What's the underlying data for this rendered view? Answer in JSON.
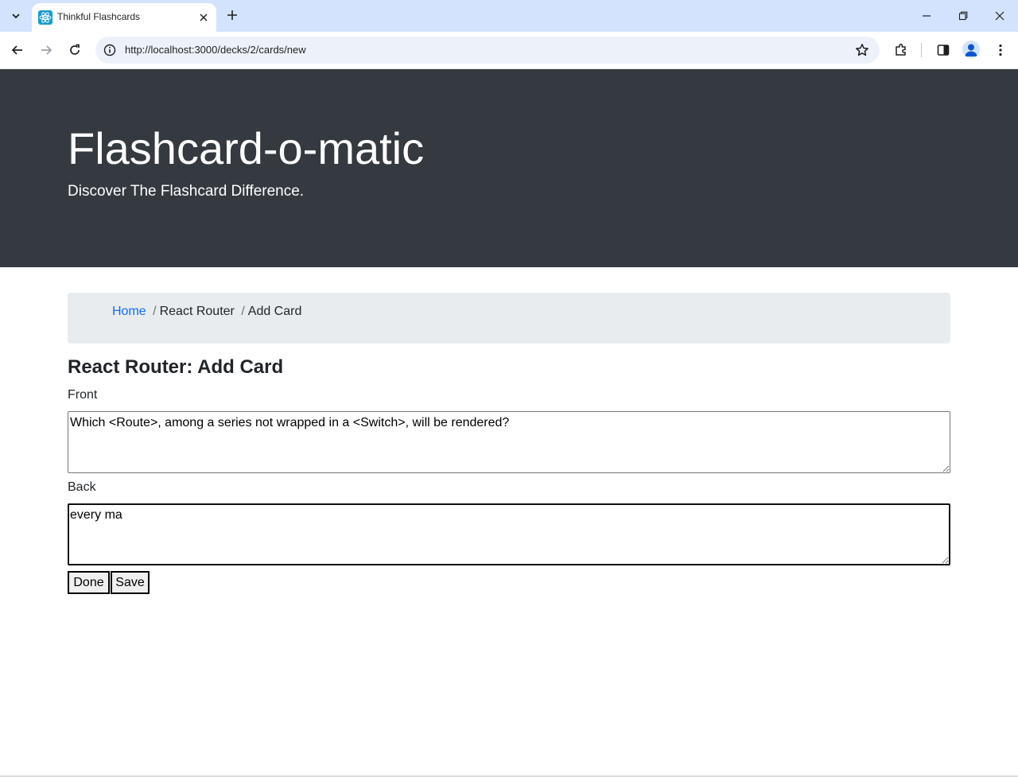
{
  "browser": {
    "tab_title": "Thinkful Flashcards",
    "url": "http://localhost:3000/decks/2/cards/new",
    "colors": {
      "tabbar_bg": "#d3e3fd",
      "omnibox_bg": "#edf2fa",
      "favicon": "#149eca"
    },
    "icons": [
      "tab-list-icon",
      "react-favicon-icon",
      "close-tab-icon",
      "new-tab-icon",
      "minimize-icon",
      "restore-icon",
      "close-window-icon",
      "back-icon",
      "forward-icon",
      "reload-icon",
      "site-info-icon",
      "bookmark-star-icon",
      "extensions-icon",
      "side-panel-icon",
      "profile-icon",
      "menu-icon"
    ]
  },
  "header": {
    "title": "Flashcard-o-matic",
    "tagline": "Discover The Flashcard Difference.",
    "bg_color": "#343a40"
  },
  "breadcrumb": {
    "home": "Home",
    "deck": "React Router",
    "current": "Add Card",
    "separator": "/"
  },
  "page": {
    "heading": "React Router: Add Card"
  },
  "form": {
    "front_label": "Front",
    "front_value": "Which <Route>, among a series not wrapped in a <Switch>, will be rendered?",
    "back_label": "Back",
    "back_value": "every ma",
    "done_label": "Done",
    "save_label": "Save"
  }
}
